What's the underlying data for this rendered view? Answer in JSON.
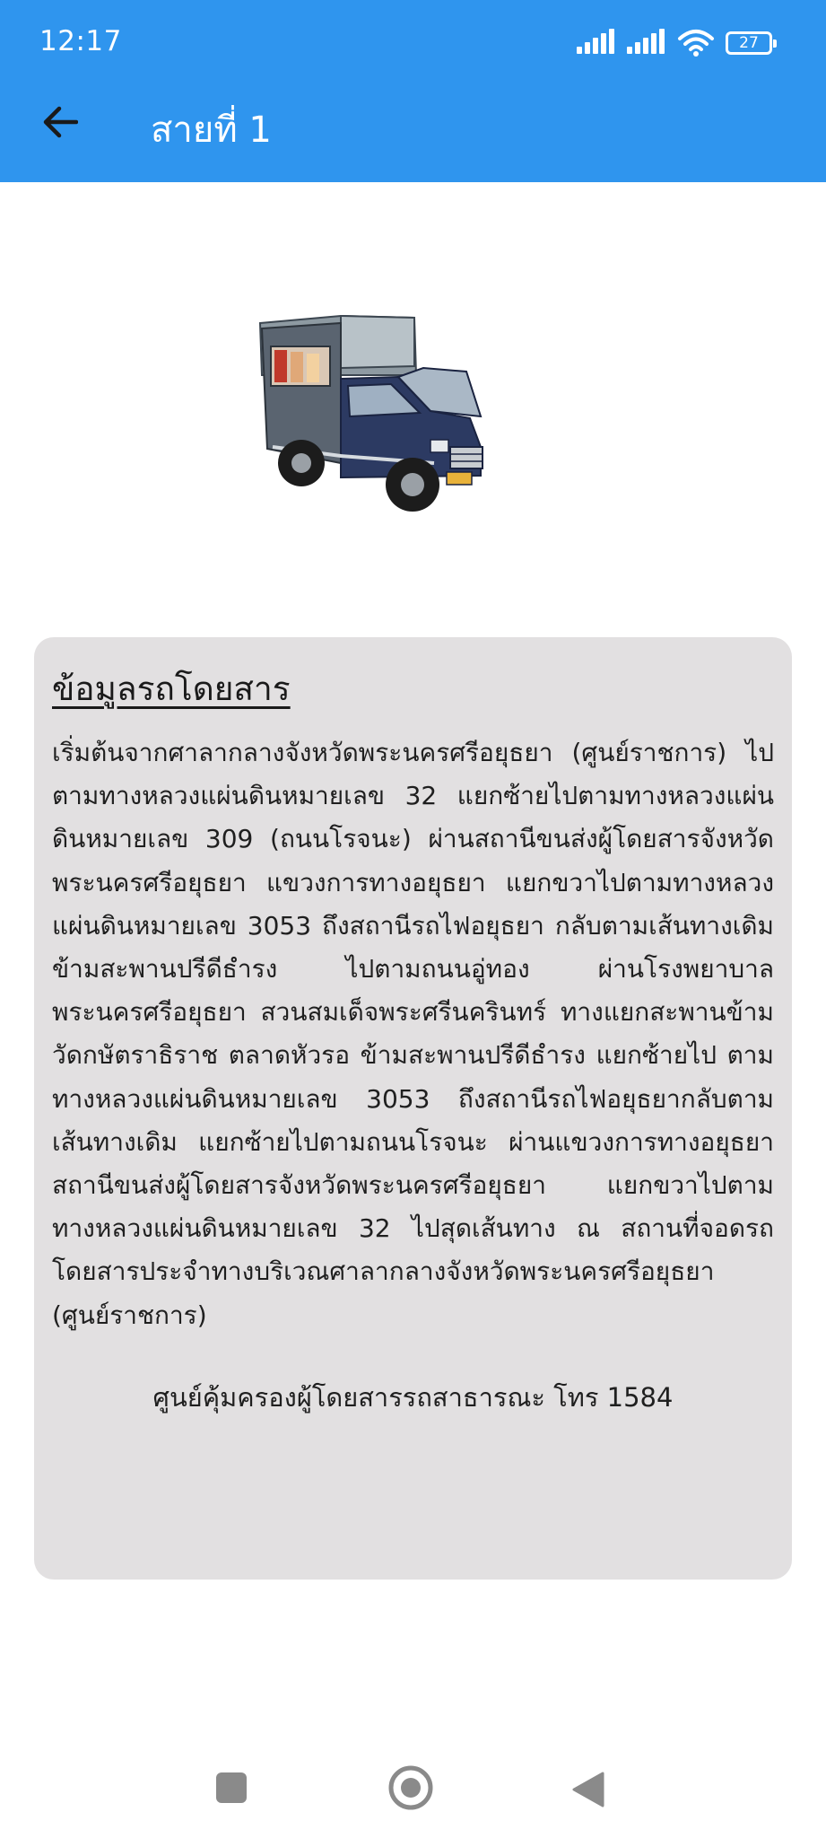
{
  "status_bar": {
    "time": "12:17",
    "battery": "27"
  },
  "app_bar": {
    "title": "สายที่ 1",
    "back_icon": "arrow-left-icon",
    "color": "#2f95ee"
  },
  "info": {
    "heading": "ข้อมูลรถโดยสาร",
    "description": "เริ่มต้นจากศาลากลางจังหวัดพระนครศรีอยุธยา (ศูนย์ราชการ) ไปตามทางหลวงแผ่นดินหมายเลข 32 แยกซ้ายไปตามทางหลวงแผ่นดินหมายเลข 309 (ถนนโรจนะ) ผ่านสถานีขนส่งผู้โดยสารจังหวัดพระนครศรีอยุธยา แขวงการทางอยุธยา แยกขวาไปตามทางหลวงแผ่นดินหมายเลข 3053 ถึงสถานีรถไฟอยุธยา กลับตามเส้นทางเดิม ข้ามสะพานปรีดีธำรง ไปตามถนนอู่ทอง ผ่านโรงพยาบาลพระนครศรีอยุธยา สวนสมเด็จพระศรีนครินทร์ ทางแยกสะพานข้ามวัดกษัตราธิราช ตลาดหัวรอ ข้ามสะพานปรีดีธำรง แยกซ้ายไป ตามทางหลวงแผ่นดินหมายเลข 3053 ถึงสถานีรถไฟอยุธยากลับตามเส้นทางเดิม แยกซ้ายไปตามถนนโรจนะ ผ่านแขวงการทางอยุธยา สถานีขนส่งผู้โดยสารจังหวัดพระนครศรีอยุธยา แยกขวาไปตามทางหลวงแผ่นดินหมายเลข 32 ไปสุดเส้นทาง ณ สถานที่จอดรถโดยสารประจำทางบริเวณศาลากลางจังหวัดพระนครศรีอยุธยา (ศูนย์ราชการ)",
    "hotline": "ศูนย์คุ้มครองผู้โดยสารรถสาธารณะ โทร 1584",
    "card_color": "#e2e0e1"
  },
  "nav_bar": {
    "recents_icon": "square-icon",
    "home_icon": "circle-home-icon",
    "back_icon": "triangle-back-icon"
  }
}
